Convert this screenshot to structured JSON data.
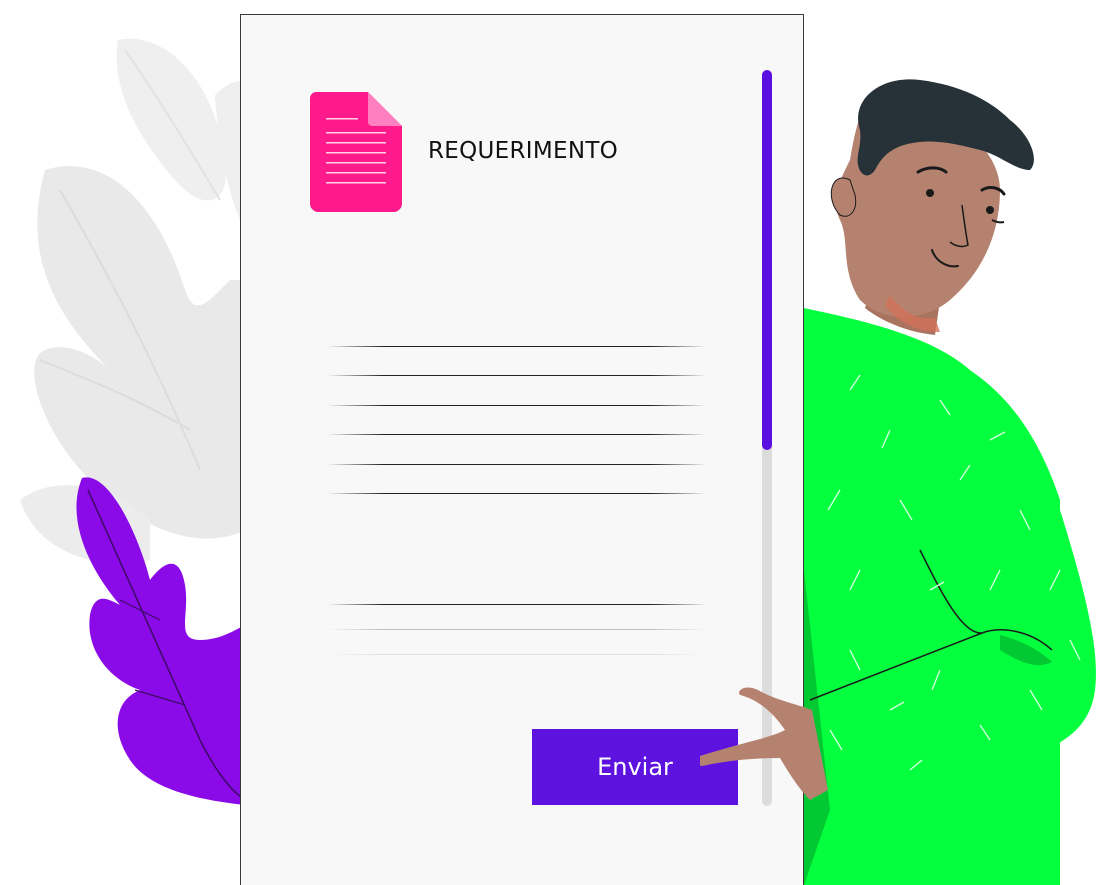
{
  "document": {
    "title": "REQUERIMENTO",
    "icon": "document-icon"
  },
  "form": {
    "submit_label": "Enviar"
  },
  "colors": {
    "doc_icon": "#ff1a8c",
    "doc_icon_fold": "#ff80c0",
    "scroll_thumb": "#5a10e0",
    "button": "#5e12e0",
    "shirt": "#04ff3f",
    "shirt_dark": "#02c832",
    "skin": "#b5826f",
    "hair": "#263238",
    "leaf_purple": "#8a0ae8",
    "leaf_grey": "#ececec"
  }
}
